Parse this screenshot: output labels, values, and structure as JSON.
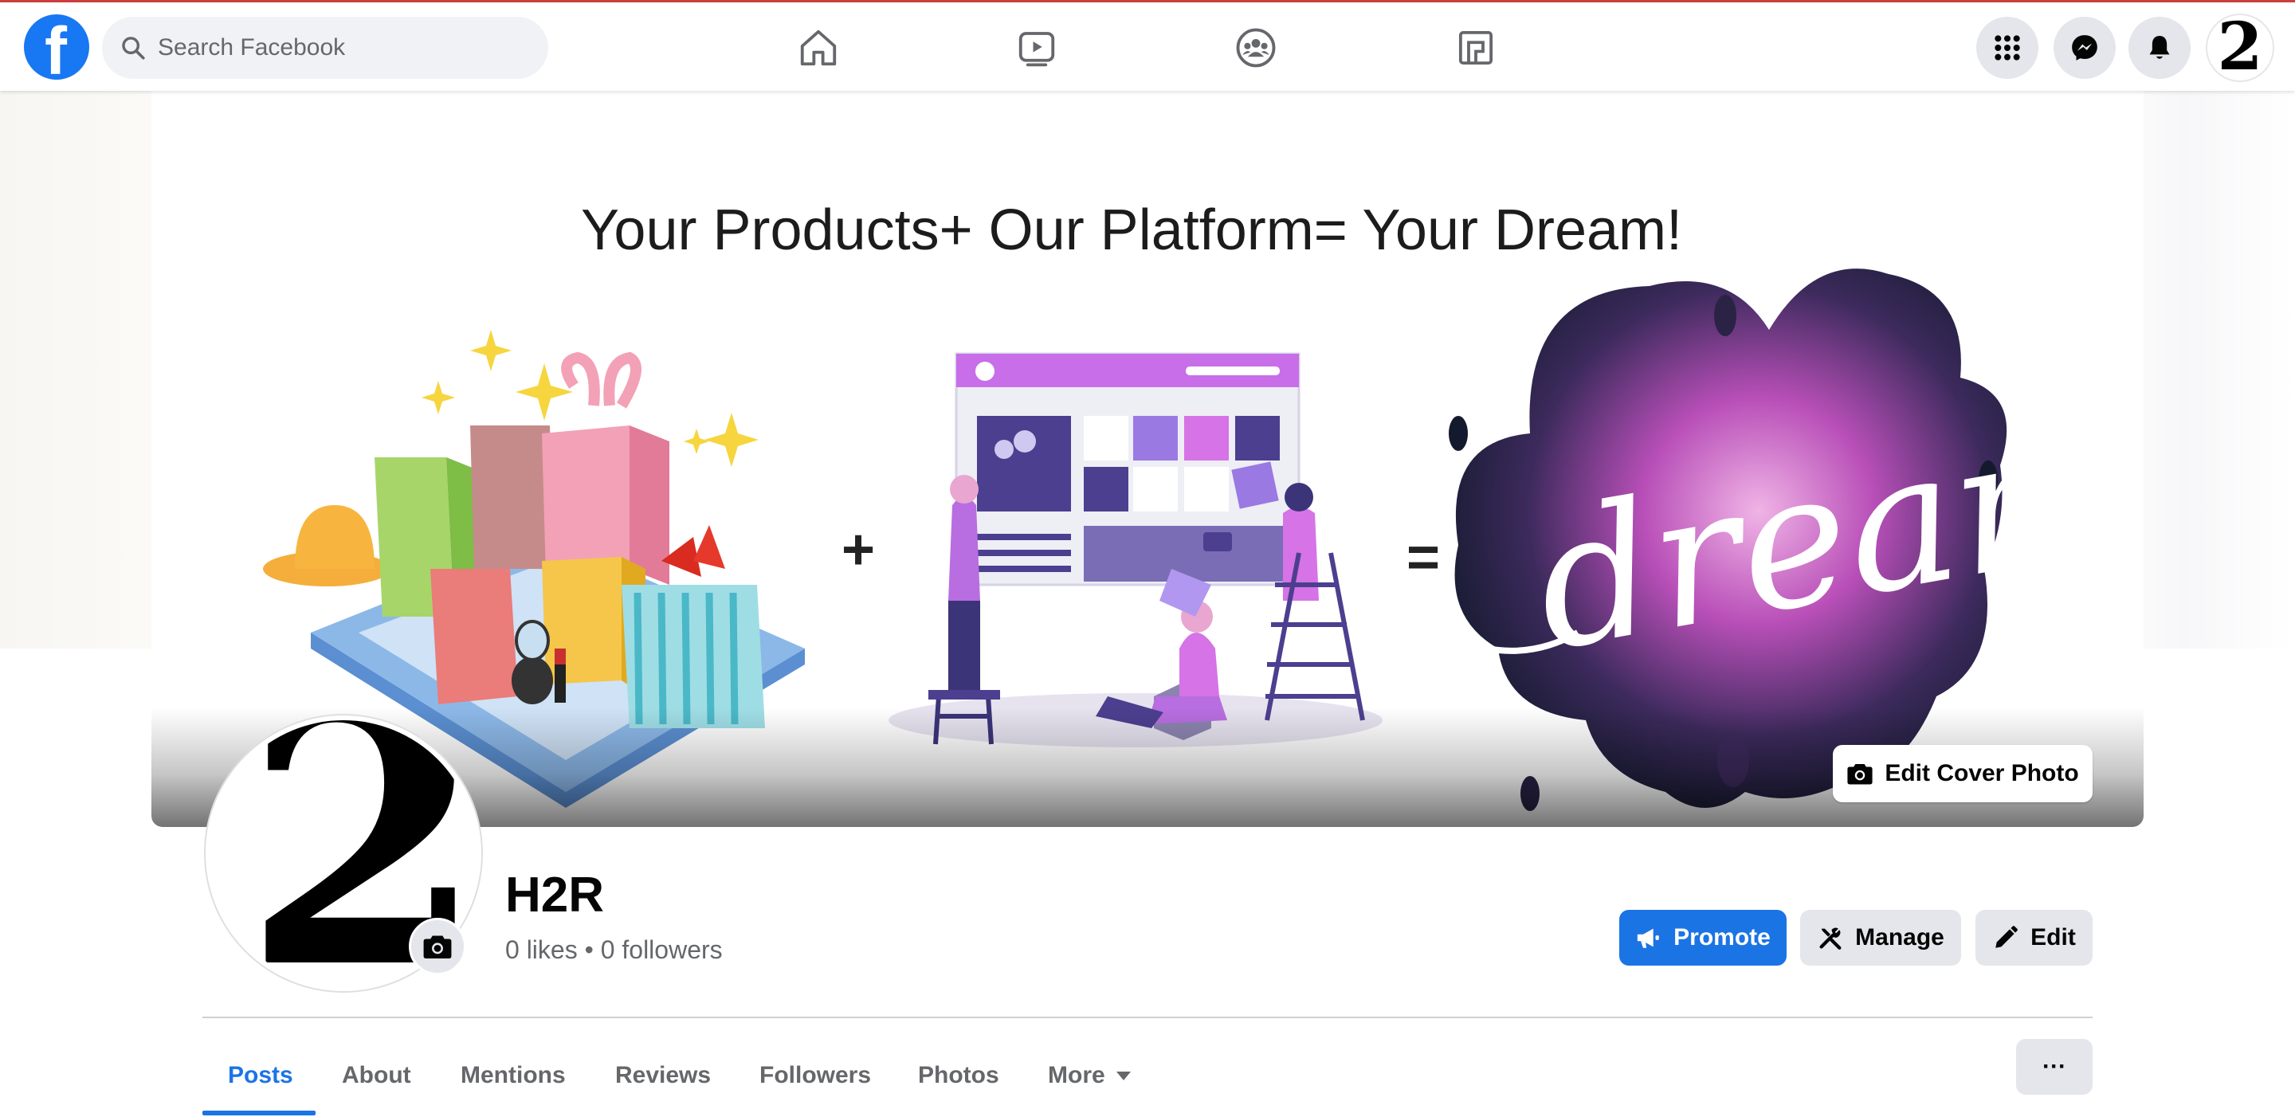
{
  "topnav": {
    "search_placeholder": "Search Facebook",
    "logo_letter": "f",
    "tabs": [
      "home-icon",
      "watch-icon",
      "groups-icon",
      "gaming-icon"
    ],
    "right_buttons": [
      "menu-grid-icon",
      "messenger-icon",
      "notifications-icon"
    ],
    "account_initial": "2"
  },
  "cover": {
    "tagline": "Your Products+ Our Platform= Your Dream!",
    "plus_sign": "+",
    "equals_sign": "=",
    "dream_word": "dreams",
    "edit_cover_label": "Edit Cover Photo"
  },
  "profile": {
    "avatar_initial": "2",
    "name": "H2R",
    "stats": "0 likes • 0 followers"
  },
  "actions": {
    "promote_label": "Promote",
    "manage_label": "Manage",
    "edit_label": "Edit"
  },
  "tabs": {
    "items": [
      "Posts",
      "About",
      "Mentions",
      "Reviews",
      "Followers",
      "Photos",
      "More"
    ],
    "active": "Posts",
    "more_button": "···"
  },
  "colors": {
    "brand_blue": "#1877f2",
    "action_blue": "#1b74e4",
    "secondary_button": "#e4e6eb",
    "muted_text": "#65676b"
  }
}
